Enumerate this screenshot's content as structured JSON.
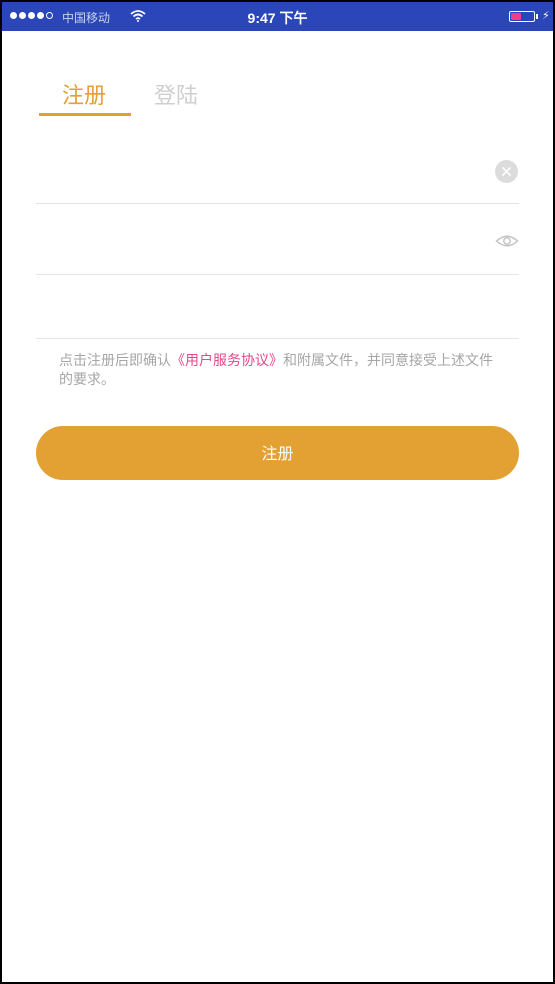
{
  "status_bar": {
    "carrier": "中国移动",
    "time": "9:47 下午",
    "signal_full_dots": 4,
    "signal_empty_dots": 1
  },
  "tabs": [
    {
      "label": "注册",
      "active": true
    },
    {
      "label": "登陆",
      "active": false
    }
  ],
  "fields": [
    {
      "value": "",
      "placeholder": ""
    },
    {
      "value": "",
      "placeholder": ""
    },
    {
      "value": "",
      "placeholder": ""
    }
  ],
  "agreement": {
    "prefix": "点击注册后即确认",
    "link": "《用户服务协议》",
    "suffix": "和附属文件，并同意接受上述文件的要求。"
  },
  "submit_label": "注册",
  "colors": {
    "accent": "#e3a033",
    "link": "#e8468c",
    "status_bar": "#2a46b8"
  },
  "icons": {
    "clear": "clear-icon",
    "toggle_password": "eye-icon"
  }
}
